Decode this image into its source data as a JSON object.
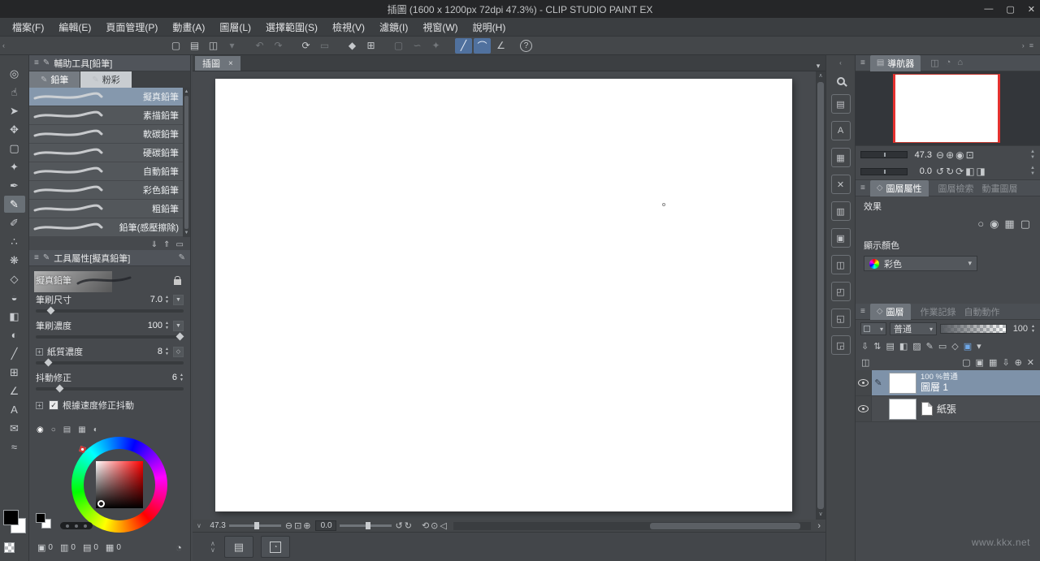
{
  "titlebar": {
    "title": "插圖 (1600 x 1200px 72dpi 47.3%)  - CLIP STUDIO PAINT EX",
    "minimize": "—",
    "maximize": "▢",
    "close": "✕"
  },
  "menu": {
    "items": [
      "檔案(F)",
      "編輯(E)",
      "頁面管理(P)",
      "動畫(A)",
      "圖層(L)",
      "選擇範圍(S)",
      "檢視(V)",
      "濾鏡(I)",
      "視窗(W)",
      "說明(H)"
    ]
  },
  "toolbar": {
    "icons": [
      {
        "n": "new-canvas-icon",
        "g": "▢"
      },
      {
        "n": "open-file-icon",
        "g": "▤"
      },
      {
        "n": "save-icon",
        "g": "◫"
      },
      {
        "n": "save-menu-icon",
        "g": "▾",
        "cls": "dim"
      },
      {
        "n": "undo-icon",
        "g": "↶",
        "cls": "gap dim"
      },
      {
        "n": "redo-icon",
        "g": "↷",
        "cls": "dim"
      },
      {
        "n": "refresh-icon",
        "g": "⟳",
        "cls": "gap"
      },
      {
        "n": "deselect-icon",
        "g": "▭",
        "cls": "dim"
      },
      {
        "n": "eraser-all-icon",
        "g": "◆",
        "cls": "gap"
      },
      {
        "n": "crop-icon",
        "g": "⊞"
      },
      {
        "n": "rect-select-icon",
        "g": "▢",
        "cls": "gap dim"
      },
      {
        "n": "lasso-select-icon",
        "g": "∽",
        "cls": "dim"
      },
      {
        "n": "magic-wand-icon",
        "g": "✦",
        "cls": "dim"
      },
      {
        "n": "snap-ruler-icon",
        "g": "╱",
        "cls": "gap on"
      },
      {
        "n": "snap-special-ruler-icon",
        "g": "⌒",
        "cls": "on"
      },
      {
        "n": "snap-grid-icon",
        "g": "∠"
      },
      {
        "n": "help-icon",
        "g": "?",
        "cls": "help"
      }
    ]
  },
  "left_tools": {
    "icons": [
      {
        "n": "zoom-tool-icon",
        "g": "◎"
      },
      {
        "n": "hand-tool-icon",
        "g": "☝"
      },
      {
        "n": "operate-tool-icon",
        "g": "➤"
      },
      {
        "n": "move-layer-tool-icon",
        "g": "✥"
      },
      {
        "n": "selection-tool-icon",
        "g": "▢"
      },
      {
        "n": "auto-select-tool-icon",
        "g": "✦"
      },
      {
        "n": "pen-tool-icon",
        "g": "✒"
      },
      {
        "n": "pencil-tool-icon",
        "g": "✎",
        "sel": true
      },
      {
        "n": "brush-tool-icon",
        "g": "✐"
      },
      {
        "n": "airbrush-tool-icon",
        "g": "∴"
      },
      {
        "n": "decoration-tool-icon",
        "g": "❋"
      },
      {
        "n": "eraser-tool-icon",
        "g": "◇"
      },
      {
        "n": "blend-tool-icon",
        "g": "◒"
      },
      {
        "n": "fill-tool-icon",
        "g": "◧"
      },
      {
        "n": "gradient-tool-icon",
        "g": "◐"
      },
      {
        "n": "figure-tool-icon",
        "g": "╱"
      },
      {
        "n": "frame-tool-icon",
        "g": "⊞"
      },
      {
        "n": "ruler-tool-icon",
        "g": "∠"
      },
      {
        "n": "text-tool-icon",
        "g": "A"
      },
      {
        "n": "balloon-tool-icon",
        "g": "✉"
      },
      {
        "n": "line-correct-tool-icon",
        "g": "≈"
      }
    ]
  },
  "subtool": {
    "header": "輔助工具[鉛筆]",
    "tabs": [
      {
        "label": "鉛筆",
        "sel": true
      },
      {
        "label": "粉彩"
      }
    ],
    "brushes": [
      {
        "name": "擬真鉛筆",
        "sel": true
      },
      {
        "name": "素描鉛筆"
      },
      {
        "name": "軟碳鉛筆"
      },
      {
        "name": "硬碳鉛筆"
      },
      {
        "name": "自動鉛筆"
      },
      {
        "name": "彩色鉛筆"
      },
      {
        "name": "粗鉛筆"
      },
      {
        "name": "鉛筆(感壓擦除)"
      }
    ],
    "footer_icons": [
      {
        "n": "import-subtool-icon",
        "g": "⇓"
      },
      {
        "n": "export-subtool-icon",
        "g": "⇑"
      },
      {
        "n": "delete-subtool-icon",
        "g": "▭"
      }
    ]
  },
  "tool_property": {
    "header": "工具屬性[擬真鉛筆]",
    "brush_name": "擬真鉛筆",
    "sliders": [
      {
        "label": "筆刷尺寸",
        "value": "7.0",
        "pos": 10
      },
      {
        "label": "筆刷濃度",
        "value": "100",
        "pos": 97
      },
      {
        "label": "紙質濃度",
        "value": "8",
        "pos": 8
      },
      {
        "label": "抖動修正",
        "value": "6",
        "pos": 16
      }
    ],
    "checkbox_label": "根據速度修正抖動",
    "footer_icons": [
      {
        "n": "history-reset-icon",
        "g": "◷"
      },
      {
        "n": "subtool-settings-icon",
        "g": "✱"
      }
    ]
  },
  "colorpanel": {
    "tabs": [
      {
        "n": "color-wheel-tab-icon",
        "g": "◉",
        "cls": "ctab sel"
      },
      {
        "n": "color-circle-tab-icon",
        "g": "○",
        "cls": "ctab"
      },
      {
        "n": "color-slider-tab-icon",
        "g": "▤",
        "cls": "ctab"
      },
      {
        "n": "color-set-tab-icon",
        "g": "▦",
        "cls": "ctab"
      },
      {
        "n": "color-mixer-tab-icon",
        "g": "◐",
        "cls": "ctab"
      }
    ]
  },
  "canvas": {
    "tab": "插圖",
    "zoom": "47.3",
    "rotation": "0.0",
    "zoom_icons": [
      {
        "n": "zoom-out-icon",
        "g": "⊖"
      },
      {
        "n": "zoom-reset-icon",
        "g": "⊡"
      },
      {
        "n": "zoom-in-icon",
        "g": "⊕"
      }
    ],
    "rot_icons": [
      {
        "n": "rotate-ccw-icon",
        "g": "↺"
      },
      {
        "n": "rotate-cw-icon",
        "g": "↻"
      }
    ],
    "nav_icons": [
      {
        "n": "reset-view-icon",
        "g": "⟲"
      },
      {
        "n": "fit-screen-icon",
        "g": "⊙"
      },
      {
        "n": "flip-horizontal-icon",
        "g": "◁"
      }
    ]
  },
  "navigator": {
    "title": "導航器",
    "zoom": "47.3",
    "rotation": "0.0",
    "dim_icons": [
      {
        "n": "subview-tab-icon",
        "g": "◫"
      },
      {
        "n": "info-tab-icon",
        "g": "◔"
      },
      {
        "n": "item-bank-tab-icon",
        "g": "⌂"
      }
    ],
    "zoom_icons": [
      {
        "n": "nav-zoom-out-icon",
        "g": "⊖"
      },
      {
        "n": "nav-zoom-in-icon",
        "g": "⊕"
      },
      {
        "n": "nav-zoom-fit-icon",
        "g": "◉"
      },
      {
        "n": "nav-zoom-100-icon",
        "g": "⊡"
      }
    ],
    "rot_icons": [
      {
        "n": "nav-rotate-ccw-icon",
        "g": "↺"
      },
      {
        "n": "nav-rotate-cw-icon",
        "g": "↻"
      },
      {
        "n": "nav-reset-rotation-icon",
        "g": "⟳"
      },
      {
        "n": "nav-flip-h-icon",
        "g": "◧"
      },
      {
        "n": "nav-flip-v-icon",
        "g": "◨"
      }
    ]
  },
  "layer_property": {
    "tab": "圖層屬性",
    "dim_tabs": [
      "圖層檢索",
      "動畫圖層"
    ],
    "effect_label": "效果",
    "effect_icons": [
      {
        "n": "border-effect-icon",
        "g": "○"
      },
      {
        "n": "border-edge-icon",
        "g": "◉"
      },
      {
        "n": "tone-effect-icon",
        "g": "▦"
      },
      {
        "n": "layer-reflect-icon",
        "g": "▢"
      }
    ],
    "display_color_label": "顯示顏色",
    "display_color": "彩色"
  },
  "layer_panel": {
    "tab": "圖層",
    "dim_tabs": [
      "作業記錄",
      "自動動作"
    ],
    "blend_mode": "普通",
    "opacity": "100",
    "cmd1": [
      {
        "n": "blend-to-below-icon",
        "g": "⇩"
      },
      {
        "n": "transfer-layer-icon",
        "g": "⇅"
      },
      {
        "n": "ref-layer-icon",
        "g": "▤"
      },
      {
        "n": "lock-layer-icon",
        "g": "◧"
      },
      {
        "n": "lock-alpha-icon",
        "g": "▨"
      },
      {
        "n": "draft-layer-icon",
        "g": "✎"
      },
      {
        "n": "layer-mask-icon",
        "g": "▭"
      },
      {
        "n": "ruler-layer-icon",
        "g": "◇"
      },
      {
        "n": "layer-color-icon",
        "g": "▣",
        "cls": "blue"
      },
      {
        "n": "layer-menu-icon",
        "g": "▾",
        "cls": "dim"
      }
    ],
    "cmd2": [
      {
        "n": "palette-dock-icon",
        "g": "◫"
      },
      {
        "n": "new-raster-layer-icon",
        "g": "▢",
        "cls": "push"
      },
      {
        "n": "new-vector-layer-icon",
        "g": "▣"
      },
      {
        "n": "new-folder-icon",
        "g": "▦"
      },
      {
        "n": "transfer-down-icon",
        "g": "⇩"
      },
      {
        "n": "combine-below-icon",
        "g": "⊕"
      },
      {
        "n": "delete-layer-icon",
        "g": "✕"
      }
    ],
    "layers": [
      {
        "info": "100 %普通",
        "name": "圖層 1",
        "sel": true
      },
      {
        "name": "紙張"
      }
    ]
  },
  "materials": {
    "icons": [
      {
        "n": "material-color-pattern-icon",
        "g": "▤"
      },
      {
        "n": "material-monochrome-icon",
        "g": "A"
      },
      {
        "n": "material-manga-icon",
        "g": "▦"
      },
      {
        "n": "material-image-icon",
        "g": "✕"
      },
      {
        "n": "material-3d-icon",
        "g": "▥"
      },
      {
        "n": "material-pose-icon",
        "g": "▣"
      },
      {
        "n": "material-primitive-icon",
        "g": "◫"
      },
      {
        "n": "material-frame-icon",
        "g": "◰"
      },
      {
        "n": "material-balloon-icon",
        "g": "◱"
      },
      {
        "n": "material-download-icon",
        "g": "◲"
      }
    ]
  },
  "statusbar": {
    "counters": [
      {
        "n": "status-cell-icon",
        "g": "▣",
        "v": "0"
      },
      {
        "n": "status-page-icon",
        "g": "▥",
        "v": "0"
      },
      {
        "n": "status-layer-icon",
        "g": "▤",
        "v": "0"
      },
      {
        "n": "status-frame-icon",
        "g": "▦",
        "v": "0"
      }
    ]
  },
  "icons": {
    "menu": "≡",
    "pencil": "✎",
    "x": "×",
    "dd": "▾",
    "up": "▲",
    "down": "▼",
    "chev_l": "‹",
    "chev_r": "›",
    "chev_u": "∧",
    "chev_d": "∨",
    "plus": "+",
    "check": "✓",
    "page": "▤",
    "hex": "◇",
    "circle": "◔"
  },
  "watermark": "www.kkx.net",
  "colors": {
    "accent": "#50719e",
    "selection": "#7e92a9",
    "canvas_frame_red": "#e5312f"
  }
}
